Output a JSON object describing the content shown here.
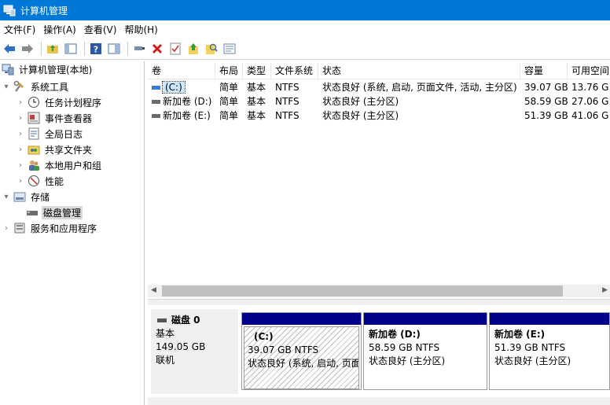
{
  "window": {
    "title": "计算机管理"
  },
  "menu": {
    "items": [
      "文件(F)",
      "操作(A)",
      "查看(V)",
      "帮助(H)"
    ]
  },
  "toolbar": {
    "icons": [
      "back-icon",
      "forward-icon",
      "folder-up-icon",
      "show-hide-tree-icon",
      "help-icon",
      "properties-view-icon",
      "connect-icon",
      "delete-icon",
      "check-icon",
      "up-arrow-icon",
      "search-icon",
      "details-icon"
    ]
  },
  "tree": {
    "root": "计算机管理(本地)",
    "system_tools": "系统工具",
    "task_scheduler": "任务计划程序",
    "event_viewer": "事件查看器",
    "shared_folders_log": "全局日志",
    "shared_folders": "共享文件夹",
    "local_users": "本地用户和组",
    "performance": "性能",
    "storage": "存储",
    "disk_management": "磁盘管理",
    "services_apps": "服务和应用程序"
  },
  "volume_table": {
    "columns": [
      "卷",
      "布局",
      "类型",
      "文件系统",
      "状态",
      "容量",
      "可用空间"
    ],
    "rows": [
      {
        "volume": "(C:)",
        "layout": "简单",
        "type": "基本",
        "fs": "NTFS",
        "status": "状态良好 (系统, 启动, 页面文件, 活动, 主分区)",
        "capacity": "39.07 GB",
        "free": "13.76 G"
      },
      {
        "volume": "新加卷 (D:)",
        "layout": "简单",
        "type": "基本",
        "fs": "NTFS",
        "status": "状态良好 (主分区)",
        "capacity": "58.59 GB",
        "free": "27.06 G"
      },
      {
        "volume": "新加卷 (E:)",
        "layout": "简单",
        "type": "基本",
        "fs": "NTFS",
        "status": "状态良好 (主分区)",
        "capacity": "51.39 GB",
        "free": "41.06 G"
      }
    ]
  },
  "disk": {
    "name": "磁盘 0",
    "type": "基本",
    "size": "149.05 GB",
    "state": "联机",
    "partitions": [
      {
        "name": "(C:)",
        "size": "39.07 GB NTFS",
        "status": "状态良好 (系统, 启动, 页面"
      },
      {
        "name": "新加卷  (D:)",
        "size": "58.59 GB NTFS",
        "status": "状态良好 (主分区)"
      },
      {
        "name": "新加卷  (E:)",
        "size": "51.39 GB NTFS",
        "status": "状态良好 (主分区)"
      }
    ]
  },
  "colors": {
    "titlebar": "#0078d7",
    "partition_bar": "#00008b",
    "selection": "#cce8ff"
  }
}
